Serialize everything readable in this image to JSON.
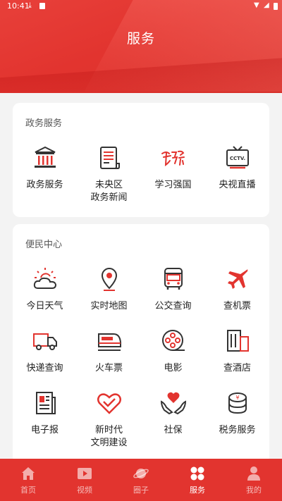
{
  "status_bar": {
    "time": "10:41"
  },
  "header": {
    "title": "服务"
  },
  "sections": [
    {
      "title": "政务服务",
      "items": [
        {
          "label": "政务服务",
          "icon": "government-building-icon"
        },
        {
          "label": "未央区\n政务新闻",
          "icon": "news-document-icon"
        },
        {
          "label": "学习强国",
          "icon": "xuexi-logo-icon"
        },
        {
          "label": "央视直播",
          "icon": "cctv-tv-icon"
        }
      ]
    },
    {
      "title": "便民中心",
      "items": [
        {
          "label": "今日天气",
          "icon": "weather-icon"
        },
        {
          "label": "实时地图",
          "icon": "map-pin-icon"
        },
        {
          "label": "公交查询",
          "icon": "bus-icon"
        },
        {
          "label": "查机票",
          "icon": "airplane-icon"
        },
        {
          "label": "快递查询",
          "icon": "delivery-truck-icon"
        },
        {
          "label": "火车票",
          "icon": "train-icon"
        },
        {
          "label": "电影",
          "icon": "film-reel-icon"
        },
        {
          "label": "查酒店",
          "icon": "hotel-icon"
        },
        {
          "label": "电子报",
          "icon": "newspaper-icon"
        },
        {
          "label": "新时代\n文明建设",
          "icon": "heart-hand-icon"
        },
        {
          "label": "社保",
          "icon": "social-security-icon"
        },
        {
          "label": "税务服务",
          "icon": "tax-coins-icon"
        }
      ]
    }
  ],
  "bottom_nav": [
    {
      "label": "首页",
      "icon": "home-icon",
      "active": false
    },
    {
      "label": "视频",
      "icon": "video-icon",
      "active": false
    },
    {
      "label": "圈子",
      "icon": "planet-icon",
      "active": false
    },
    {
      "label": "服务",
      "icon": "service-grid-icon",
      "active": true
    },
    {
      "label": "我的",
      "icon": "profile-icon",
      "active": false
    }
  ],
  "colors": {
    "brand_red": "#e2342f",
    "icon_dark": "#333333"
  }
}
